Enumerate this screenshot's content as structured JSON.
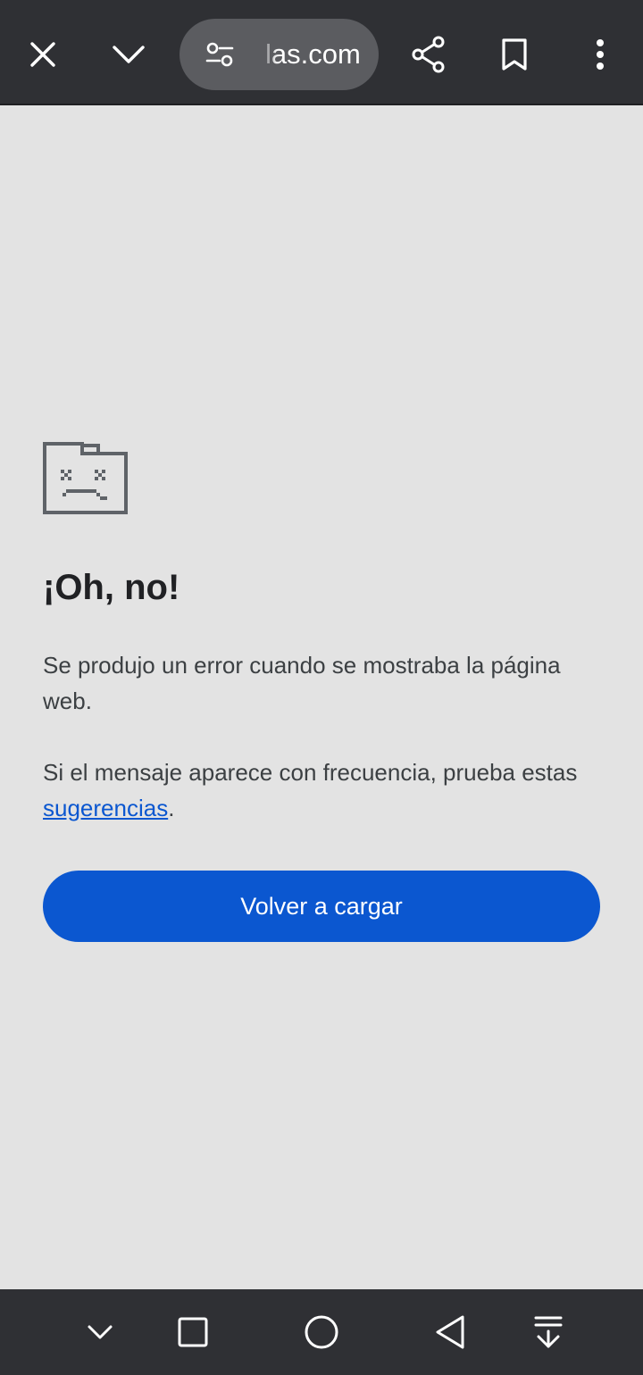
{
  "toolbar": {
    "url_text": "las.com",
    "icons": [
      "close-icon",
      "chevron-down-icon",
      "tune-icon",
      "share-icon",
      "bookmark-icon",
      "more-vert-icon"
    ]
  },
  "error_page": {
    "title": "¡Oh, no!",
    "message": "Se produjo un error cuando se mostraba la página web.",
    "hint_prefix": "Si el mensaje aparece con frecuencia, prueba estas ",
    "hint_link": "sugerencias",
    "hint_suffix": ".",
    "reload_label": "Volver a cargar"
  },
  "navbar": {
    "icons": [
      "nav-collapse-icon",
      "recents-icon",
      "home-icon",
      "back-icon",
      "download-icon"
    ]
  },
  "colors": {
    "toolbar_bg": "#2f3034",
    "page_bg": "#e3e3e3",
    "accent": "#0b57d0",
    "title_text": "#202124",
    "body_text": "#3c4043"
  }
}
